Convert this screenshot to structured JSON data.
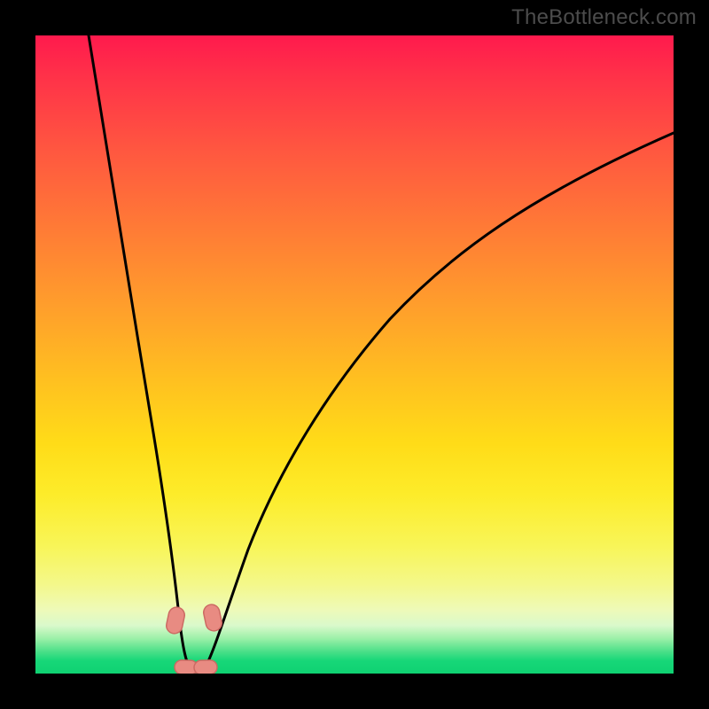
{
  "watermark": "TheBottleneck.com",
  "colors": {
    "background": "#000000",
    "gradient_top": "#ff1a4d",
    "gradient_mid": "#ffd21a",
    "gradient_bottom": "#0fd172",
    "curve": "#000000",
    "marker_fill": "#e88b82",
    "marker_stroke": "#cc6a63"
  },
  "chart_data": {
    "type": "line",
    "title": "",
    "xlabel": "",
    "ylabel": "",
    "xlim": [
      0,
      100
    ],
    "ylim": [
      0,
      100
    ],
    "note": "A bottleneck-style curve: two branches descending to a minimum near x≈24 where y≈0, with a green band (good) near the bottom grading through yellow/orange to red (bad) at the top. Values are read off by relating pixel positions to the 0–100 axes.",
    "series": [
      {
        "name": "left-branch",
        "x": [
          8.3,
          10,
          12,
          14,
          16,
          18,
          20,
          21.5,
          23,
          24
        ],
        "y": [
          100,
          90,
          77,
          64,
          51,
          38,
          25,
          15,
          6,
          0.5
        ]
      },
      {
        "name": "right-branch",
        "x": [
          26,
          28,
          30,
          33,
          37,
          42,
          48,
          55,
          63,
          72,
          82,
          92,
          100
        ],
        "y": [
          0.5,
          6,
          13,
          22,
          32,
          42,
          51,
          59,
          66,
          72,
          78,
          82,
          85
        ]
      }
    ],
    "markers": [
      {
        "name": "left-knee",
        "x": 22.2,
        "y": 8.0
      },
      {
        "name": "right-knee",
        "x": 27.5,
        "y": 8.5
      },
      {
        "name": "trough-left",
        "x": 23.3,
        "y": 0.8
      },
      {
        "name": "trough-right",
        "x": 26.4,
        "y": 0.8
      }
    ]
  }
}
